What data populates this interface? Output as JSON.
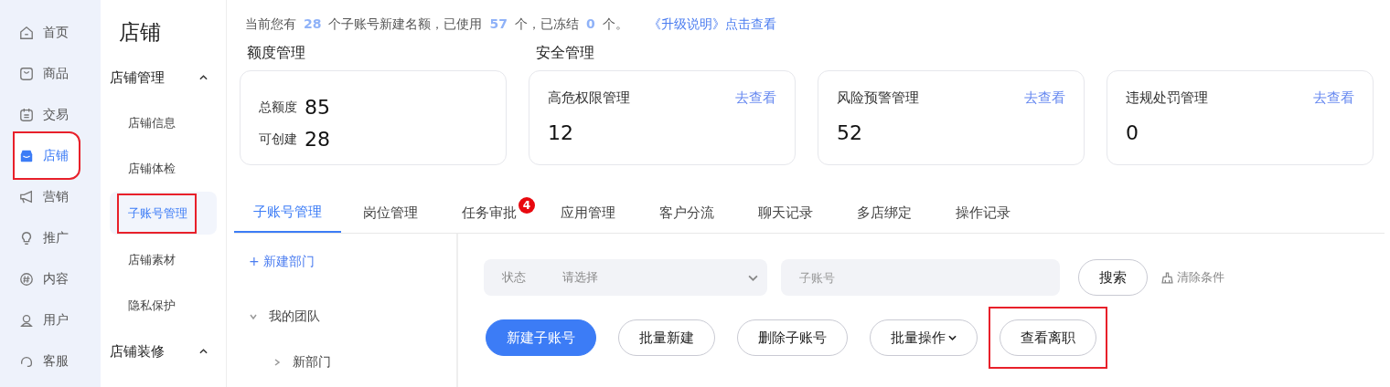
{
  "nav": {
    "items": [
      {
        "label": "首页",
        "selected": false,
        "highlighted": false
      },
      {
        "label": "商品",
        "selected": false,
        "highlighted": false
      },
      {
        "label": "交易",
        "selected": false,
        "highlighted": false
      },
      {
        "label": "店铺",
        "selected": true,
        "highlighted": true
      },
      {
        "label": "营销",
        "selected": false,
        "highlighted": false
      },
      {
        "label": "推广",
        "selected": false,
        "highlighted": false
      },
      {
        "label": "内容",
        "selected": false,
        "highlighted": false
      },
      {
        "label": "用户",
        "selected": false,
        "highlighted": false
      },
      {
        "label": "客服",
        "selected": false,
        "highlighted": false
      }
    ]
  },
  "submenu": {
    "title": "店铺",
    "groups": [
      {
        "label": "店铺管理",
        "expanded": true,
        "items": [
          {
            "label": "店铺信息",
            "selected": false,
            "highlighted": false
          },
          {
            "label": "店铺体检",
            "selected": false,
            "highlighted": false
          },
          {
            "label": "子账号管理",
            "selected": true,
            "highlighted": true
          },
          {
            "label": "店铺素材",
            "selected": false,
            "highlighted": false
          },
          {
            "label": "隐私保护",
            "selected": false,
            "highlighted": false
          }
        ]
      },
      {
        "label": "店铺装修",
        "expanded": true
      }
    ]
  },
  "notice": {
    "parts": [
      {
        "text": "当前您有",
        "kind": "plain"
      },
      {
        "text": "28",
        "kind": "number"
      },
      {
        "text": "个子账号新建名额，已使用",
        "kind": "plain"
      },
      {
        "text": "57",
        "kind": "number"
      },
      {
        "text": "个，已冻结",
        "kind": "plain"
      },
      {
        "text": "0",
        "kind": "number"
      },
      {
        "text": "个。",
        "kind": "plain"
      }
    ],
    "link": "《升级说明》点击查看"
  },
  "quota": {
    "title": "额度管理",
    "rows": [
      {
        "label": "总额度",
        "value": "85"
      },
      {
        "label": "可创建",
        "value": "28"
      }
    ]
  },
  "security": {
    "title": "安全管理",
    "cards": [
      {
        "title": "高危权限管理",
        "value": "12",
        "link": "去查看"
      },
      {
        "title": "风险预警管理",
        "value": "52",
        "link": "去查看"
      },
      {
        "title": "违规处罚管理",
        "value": "0",
        "link": "去查看"
      }
    ]
  },
  "tabs": [
    {
      "label": "子账号管理",
      "selected": true
    },
    {
      "label": "岗位管理",
      "selected": false
    },
    {
      "label": "任务审批",
      "selected": false,
      "badge": "4"
    },
    {
      "label": "应用管理",
      "selected": false
    },
    {
      "label": "客户分流",
      "selected": false
    },
    {
      "label": "聊天记录",
      "selected": false
    },
    {
      "label": "多店绑定",
      "selected": false
    },
    {
      "label": "操作记录",
      "selected": false
    }
  ],
  "departments": {
    "add_link": "+ 新建部门",
    "tree": [
      {
        "label": "我的团队",
        "expanded": true,
        "children": [
          {
            "label": "新部门",
            "expanded": false
          }
        ]
      }
    ]
  },
  "filters": {
    "status": {
      "label": "状态",
      "placeholder": "请选择"
    },
    "account": {
      "placeholder": "子账号"
    },
    "search_button": "搜索",
    "clear_link": "清除条件"
  },
  "actions": [
    {
      "label": "新建子账号",
      "kind": "primary",
      "highlighted": false
    },
    {
      "label": "批量新建",
      "kind": "outline",
      "highlighted": false
    },
    {
      "label": "删除子账号",
      "kind": "outline",
      "highlighted": false
    },
    {
      "label": "批量操作",
      "kind": "dropdown",
      "highlighted": false
    },
    {
      "label": "查看离职",
      "kind": "outline",
      "highlighted": true
    }
  ]
}
